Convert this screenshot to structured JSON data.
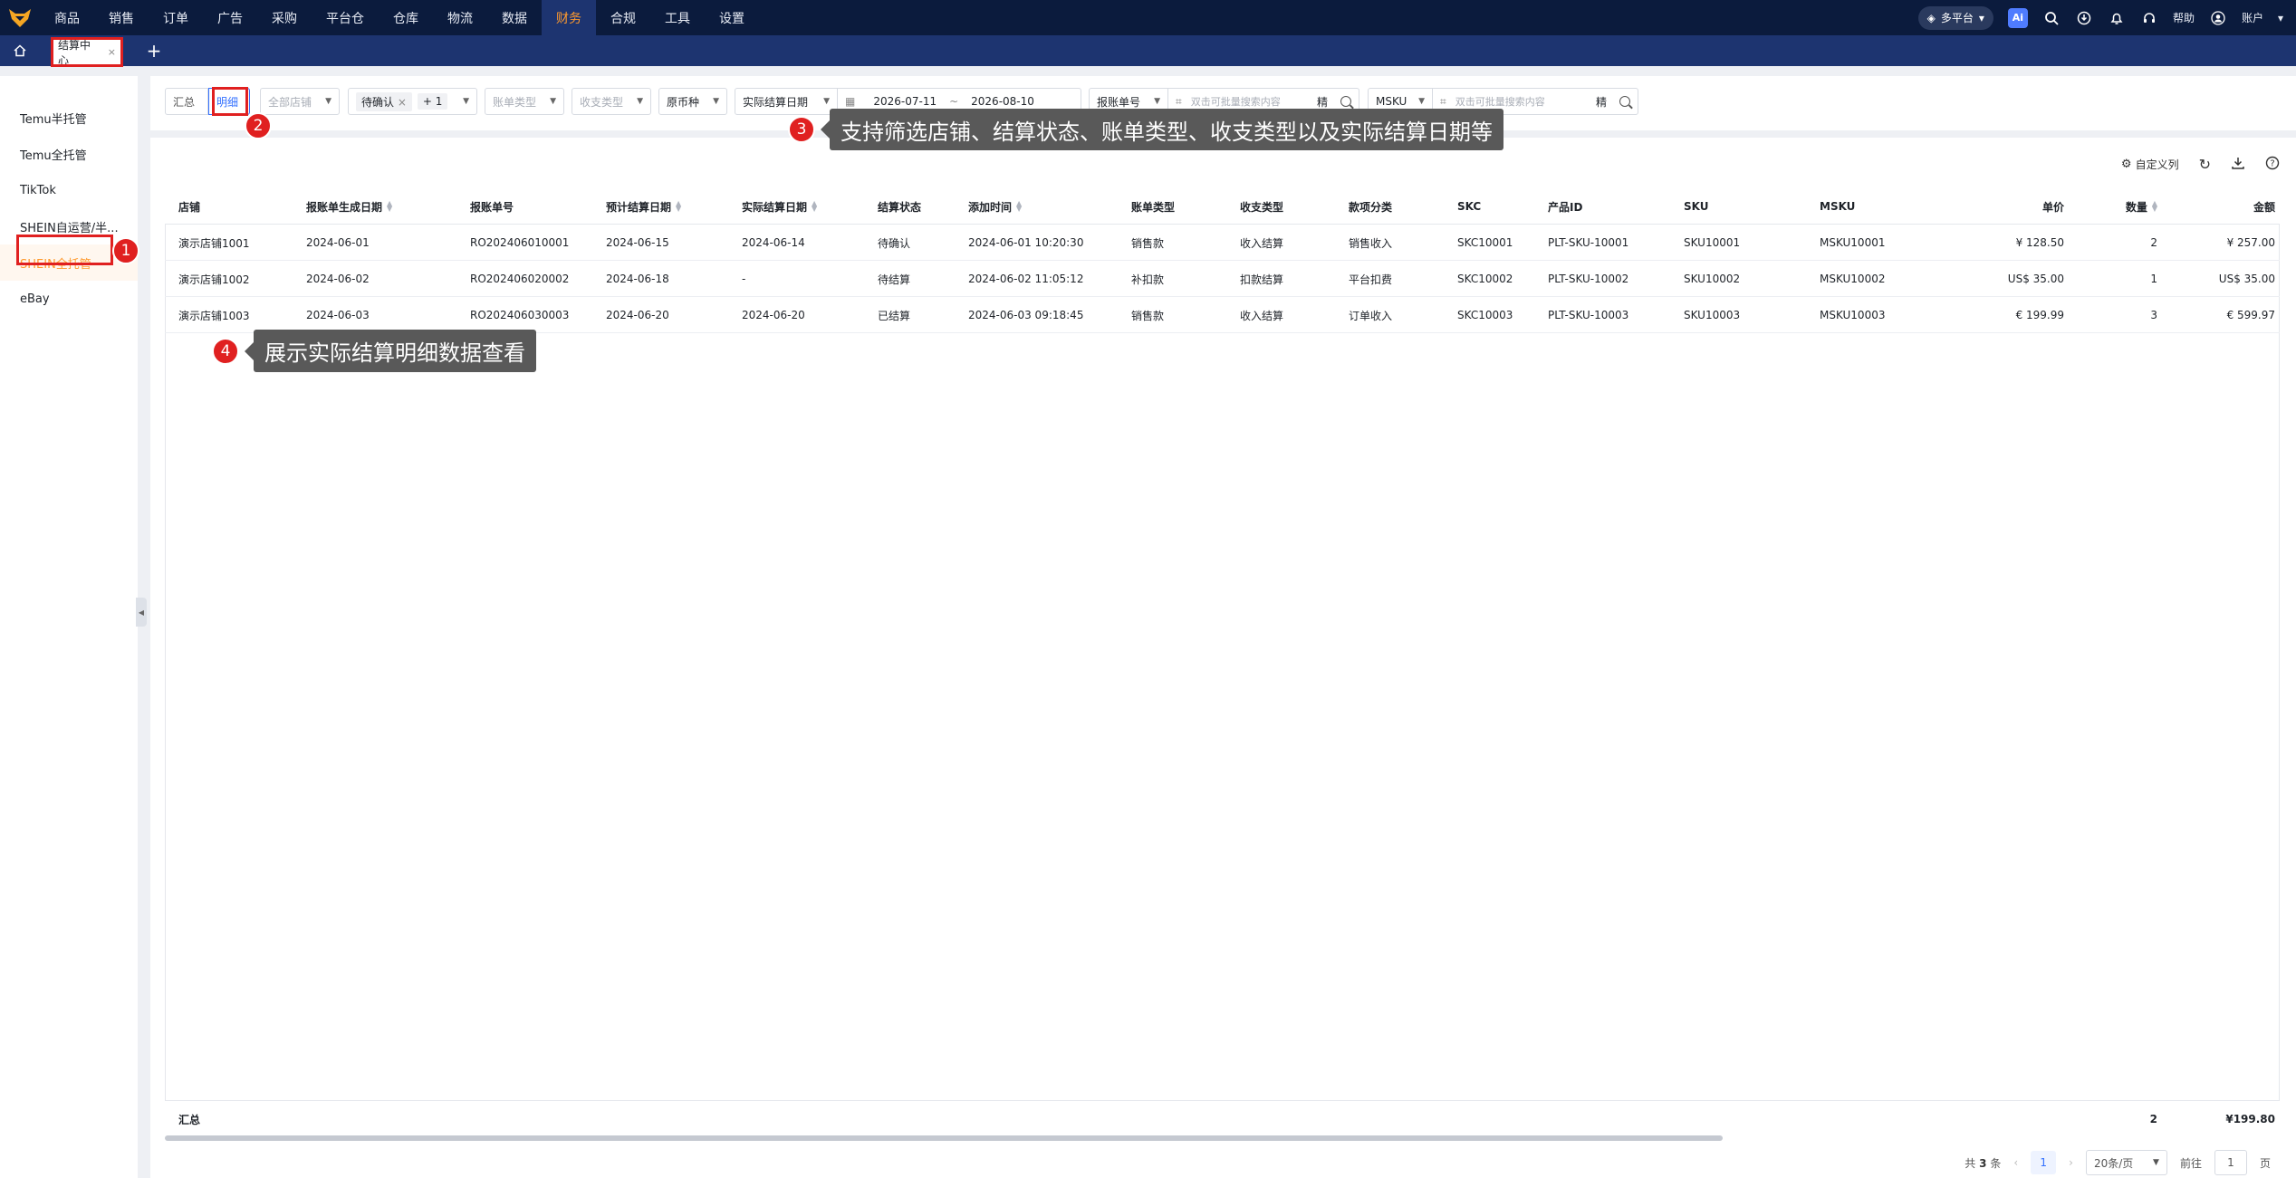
{
  "nav": {
    "items": [
      "商品",
      "销售",
      "订单",
      "广告",
      "采购",
      "平台仓",
      "仓库",
      "物流",
      "数据",
      "财务",
      "合规",
      "工具",
      "设置"
    ],
    "active": "财务",
    "platform": "多平台",
    "ai": "Ai",
    "help": "帮助",
    "account": "账户"
  },
  "tabs": {
    "current": "结算中心",
    "close": "×",
    "add": "+"
  },
  "sidebar": {
    "items": [
      "Temu半托管",
      "Temu全托管",
      "TikTok",
      "SHEIN自运营/半...",
      "SHEIN全托管",
      "eBay"
    ],
    "active_index": 4
  },
  "filters": {
    "summary_tab": "汇总",
    "detail_tab": "明细",
    "store": "全部店铺",
    "status_chip": "待确认",
    "status_more": "+ 1",
    "bill_type": "账单类型",
    "income_type": "收支类型",
    "currency": "原币种",
    "date_type": "实际结算日期",
    "date_start": "2026-07-11",
    "date_sep": "~",
    "date_end": "2026-08-10",
    "field1": "报账单号",
    "search_placeholder1": "双击可批量搜索内容",
    "exact": "精",
    "field2": "MSKU",
    "search_placeholder2": "双击可批量搜索内容"
  },
  "toolbar": {
    "custom_columns": "自定义列"
  },
  "table": {
    "headers": [
      "店铺",
      "报账单生成日期",
      "报账单号",
      "预计结算日期",
      "实际结算日期",
      "结算状态",
      "添加时间",
      "账单类型",
      "收支类型",
      "款项分类",
      "SKC",
      "产品ID",
      "SKU",
      "MSKU",
      "单价",
      "数量",
      "金额"
    ],
    "rows": [
      [
        "演示店铺1001",
        "2024-06-01",
        "RO202406010001",
        "2024-06-15",
        "2024-06-14",
        "待确认",
        "2024-06-01 10:20:30",
        "销售款",
        "收入结算",
        "销售收入",
        "SKC10001",
        "PLT-SKU-10001",
        "SKU10001",
        "MSKU10001",
        "¥ 128.50",
        "2",
        "¥ 257.00"
      ],
      [
        "演示店铺1002",
        "2024-06-02",
        "RO202406020002",
        "2024-06-18",
        "-",
        "待结算",
        "2024-06-02 11:05:12",
        "补扣款",
        "扣款结算",
        "平台扣费",
        "SKC10002",
        "PLT-SKU-10002",
        "SKU10002",
        "MSKU10002",
        "US$ 35.00",
        "1",
        "US$ 35.00"
      ],
      [
        "演示店铺1003",
        "2024-06-03",
        "RO202406030003",
        "2024-06-20",
        "2024-06-20",
        "已结算",
        "2024-06-03 09:18:45",
        "销售款",
        "收入结算",
        "订单收入",
        "SKC10003",
        "PLT-SKU-10003",
        "SKU10003",
        "MSKU10003",
        "€ 199.99",
        "3",
        "€ 599.97"
      ]
    ],
    "summary_label": "汇总",
    "summary_qty": "2",
    "summary_amount": "¥199.80"
  },
  "pagination": {
    "total_prefix": "共",
    "total": "3",
    "total_suffix": "条",
    "page": "1",
    "page_size": "20条/页",
    "goto_label": "前往",
    "goto_value": "1",
    "goto_suffix": "页"
  },
  "annotations": {
    "badge1": "1",
    "badge2": "2",
    "badge3": "3",
    "badge4": "4",
    "callout3": "支持筛选店铺、结算状态、账单类型、收支类型以及实际结算日期等",
    "callout4": "展示实际结算明细数据查看"
  },
  "colors": {
    "nav_bg": "#0b1b3d",
    "tab_bar": "#1d3470",
    "accent_orange": "#ff9a2e",
    "accent_blue": "#3370ff",
    "annotation_red": "#e02020"
  }
}
